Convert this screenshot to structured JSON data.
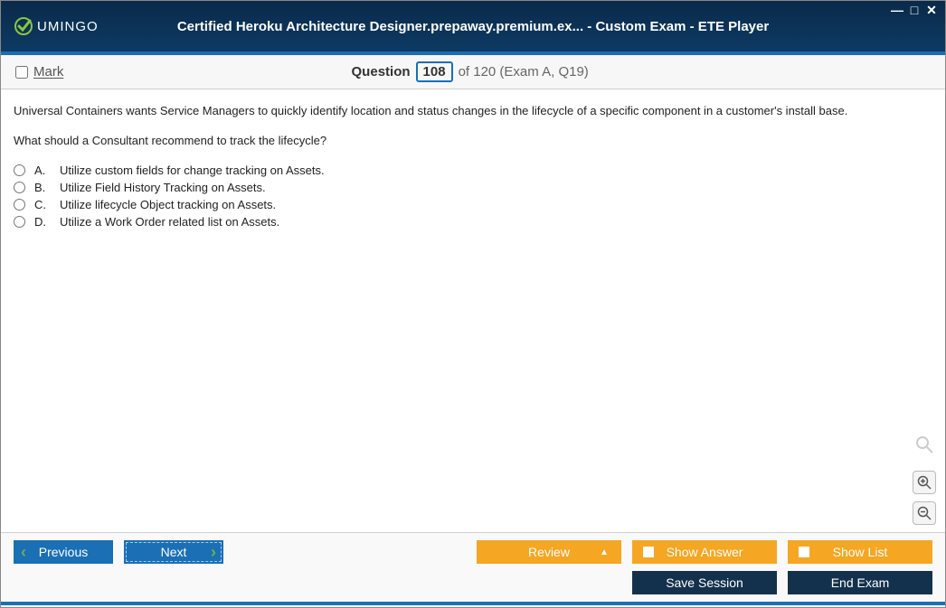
{
  "window": {
    "logo_text": "UMINGO",
    "title": "Certified Heroku Architecture Designer.prepaway.premium.ex... - Custom Exam - ETE Player"
  },
  "qbar": {
    "mark_label": "Mark",
    "question_label": "Question",
    "number": "108",
    "of_text": "of 120 (Exam A, Q19)"
  },
  "question": {
    "line1": "Universal Containers wants Service Managers to quickly identify location and status changes in the lifecycle of a specific component in a customer's install base.",
    "line2": "What should a Consultant recommend to track the lifecycle?",
    "options": [
      {
        "letter": "A.",
        "text": "Utilize custom fields for change tracking on Assets."
      },
      {
        "letter": "B.",
        "text": "Utilize Field History Tracking on Assets."
      },
      {
        "letter": "C.",
        "text": "Utilize lifecycle Object tracking on Assets."
      },
      {
        "letter": "D.",
        "text": "Utilize a Work Order related list on Assets."
      }
    ]
  },
  "footer": {
    "previous": "Previous",
    "next": "Next",
    "review": "Review",
    "show_answer": "Show Answer",
    "show_list": "Show List",
    "save_session": "Save Session",
    "end_exam": "End Exam"
  }
}
